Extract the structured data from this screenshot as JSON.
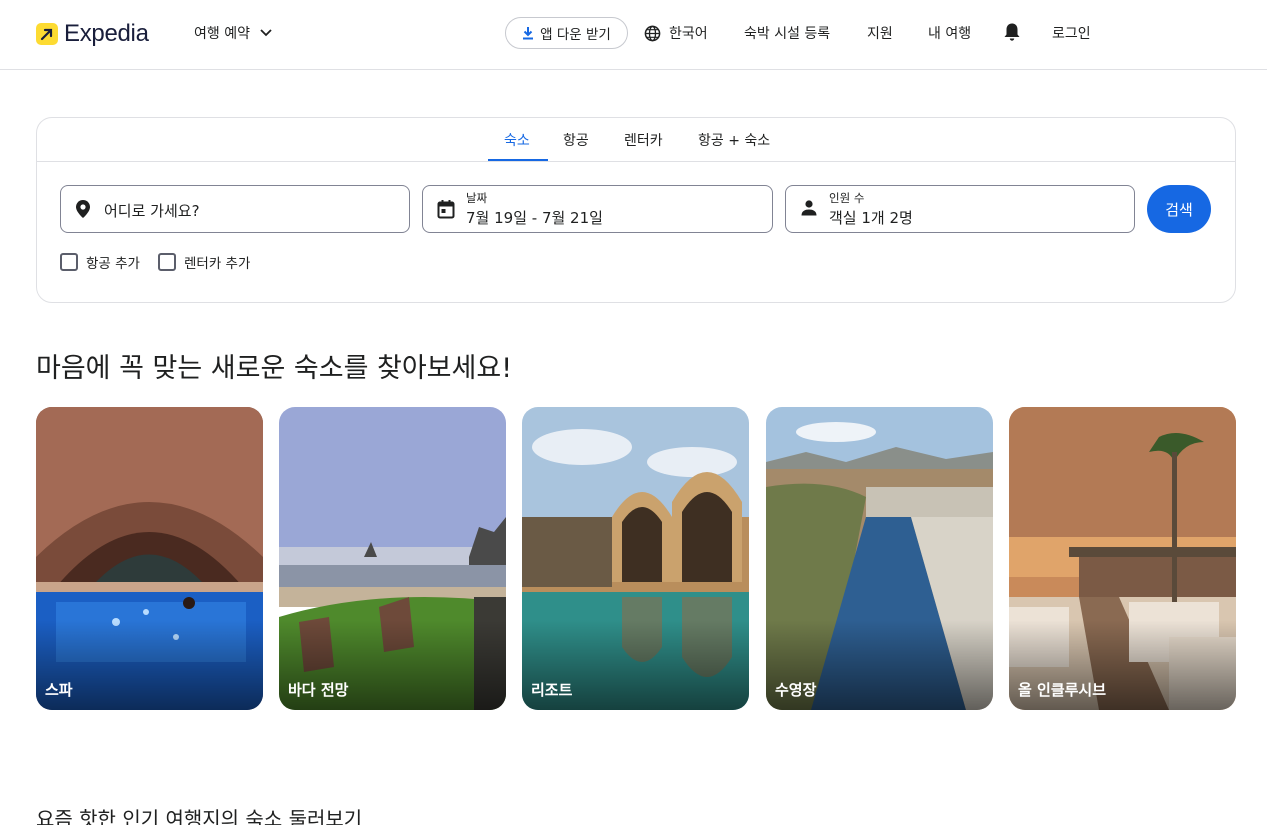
{
  "header": {
    "logo_text": "Expedia",
    "book_trip": "여행 예약",
    "app_download": "앱 다운 받기",
    "language": "한국어",
    "list_property": "숙박 시설 등록",
    "support": "지원",
    "my_trips": "내 여행",
    "login": "로그인",
    "icons": [
      "expedia-logo-icon",
      "chevron-down-icon",
      "download-icon",
      "globe-icon",
      "bell-icon"
    ]
  },
  "search": {
    "tabs": [
      {
        "label": "숙소",
        "active": true
      },
      {
        "label": "항공",
        "active": false
      },
      {
        "label": "렌터카",
        "active": false
      },
      {
        "label": "항공 + 숙소",
        "active": false
      }
    ],
    "destination_placeholder": "어디로 가세요?",
    "dates_label": "날짜",
    "dates_value": "7월 19일 - 7월 21일",
    "travelers_label": "인원 수",
    "travelers_value": "객실 1개 2명",
    "search_button": "검색",
    "add_flight": "항공 추가",
    "add_car": "렌터카 추가",
    "accent_color": "#1668e3"
  },
  "section": {
    "title": "마음에 꼭 맞는 새로운 숙소를 찾아보세요!",
    "cards": [
      {
        "label": "스파"
      },
      {
        "label": "바다 전망"
      },
      {
        "label": "리조트"
      },
      {
        "label": "수영장"
      },
      {
        "label": "올 인클루시브"
      }
    ]
  },
  "bottom": {
    "title": "요즘 핫한 인기 여행지의 숙소 둘러보기"
  }
}
